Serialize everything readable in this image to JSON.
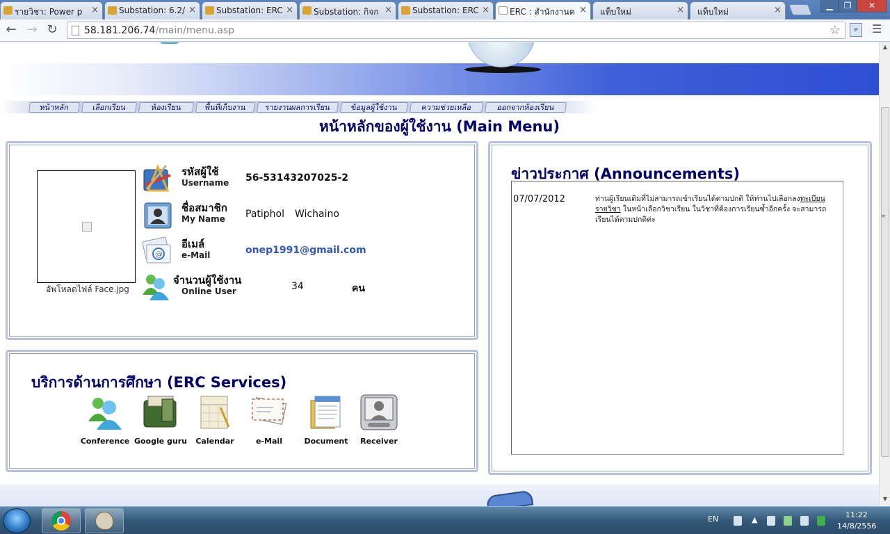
{
  "browser": {
    "tabs": [
      {
        "title": "รายวิชา: Power p",
        "favicon": "folder-icon"
      },
      {
        "title": "Substation: 6.2/",
        "favicon": "folder-icon"
      },
      {
        "title": "Substation: ERC",
        "favicon": "folder-icon"
      },
      {
        "title": "Substation: กิจก",
        "favicon": "folder-icon"
      },
      {
        "title": "Substation: ERC",
        "favicon": "folder-icon"
      },
      {
        "title": "ERC : สำนักงานค",
        "favicon": "page-icon",
        "active": true
      },
      {
        "title": "แท็บใหม่",
        "favicon": "none"
      },
      {
        "title": "แท็บใหม่",
        "favicon": "none"
      }
    ],
    "url_host": "58.181.206.74",
    "url_path": "/main/menu.asp"
  },
  "menu": [
    "หน้าหลัก",
    "เลือกเรียน",
    "ห้องเรียน",
    "พื้นที่เก็บงาน",
    "รายงานผลการเรียน",
    "ข้อมูลผู้ใช้งาน",
    "ความช่วยเหลือ",
    "ออกจากห้องเรียน"
  ],
  "page_title": "หน้าหลักของผู้ใช้งาน (Main Menu)",
  "profile": {
    "upload_caption": "อัพโหลดไฟล์ Face.jpg",
    "username_th": "รหัสผู้ใช้",
    "username_en": "Username",
    "username_value": "56-53143207025-2",
    "name_th": "ชื่อสมาชิก",
    "name_en": "My Name",
    "first_name": "Patiphol",
    "last_name": "Wichaino",
    "email_th": "อีเมล์",
    "email_en": "e-Mail",
    "email_value": "onep1991@gmail.com",
    "online_th": "จำนวนผู้ใช้งาน",
    "online_en": "Online User",
    "online_count": "34",
    "online_unit": "คน"
  },
  "services": {
    "title": "บริการด้านการศึกษา (ERC Services)",
    "items": [
      {
        "label": "Conference",
        "icon": "conference-icon"
      },
      {
        "label": "Google guru",
        "icon": "google-guru-icon"
      },
      {
        "label": "Calendar",
        "icon": "calendar-icon"
      },
      {
        "label": "e-Mail",
        "icon": "email-icon"
      },
      {
        "label": "Document",
        "icon": "document-icon"
      },
      {
        "label": "Receiver",
        "icon": "receiver-icon"
      }
    ]
  },
  "announcements": {
    "title": "ข่าวประกาศ (Announcements)",
    "date": "07/07/2012",
    "text_before": "ท่านผู้เรียนเดิมที่ไม่สามารถเข้าเรียนได้ตามปกติ ให้ท่านไปเลือกลง",
    "link_text": "ทะเบียนรายวิชา",
    "text_after": " ในหน้าเลือกวิชาเรียน ในวิชาที่ต้องการเรียนซ้ำอีกครั้ง จะสามารถเรียนได้ตามปกติค่ะ"
  },
  "taskbar": {
    "language": "EN",
    "time": "11:22",
    "date": "14/8/2556"
  },
  "colors": {
    "heading": "#000066",
    "email_link": "#3355bb",
    "banner_blue": "#2e4fd4"
  }
}
